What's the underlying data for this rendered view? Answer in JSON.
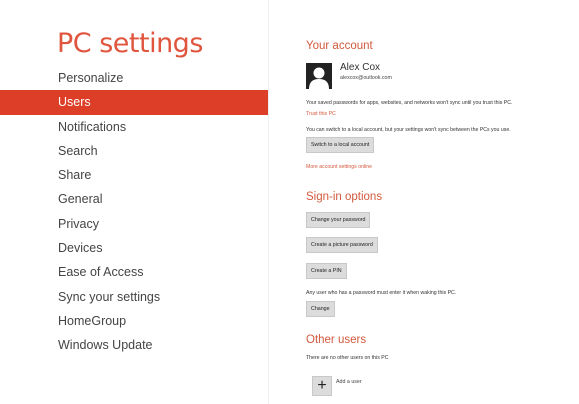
{
  "sidebar": {
    "title": "PC settings",
    "items": [
      {
        "label": "Personalize",
        "active": false
      },
      {
        "label": "Users",
        "active": true
      },
      {
        "label": "Notifications",
        "active": false
      },
      {
        "label": "Search",
        "active": false
      },
      {
        "label": "Share",
        "active": false
      },
      {
        "label": "General",
        "active": false
      },
      {
        "label": "Privacy",
        "active": false
      },
      {
        "label": "Devices",
        "active": false
      },
      {
        "label": "Ease of Access",
        "active": false
      },
      {
        "label": "Sync your settings",
        "active": false
      },
      {
        "label": "HomeGroup",
        "active": false
      },
      {
        "label": "Windows Update",
        "active": false
      }
    ]
  },
  "account": {
    "heading": "Your account",
    "user_name": "Alex Cox",
    "user_email": "alexcox@outlook.com",
    "trust_notice": "Your saved passwords for apps, websites, and networks won't sync until you trust this PC.",
    "trust_link": "Trust this PC",
    "local_notice": "You can switch to a local account, but your settings won't sync between the PCs you use.",
    "switch_button": "Switch to a local account",
    "more_link": "More account settings online"
  },
  "signin": {
    "heading": "Sign-in options",
    "change_password_button": "Change your password",
    "picture_password_button": "Create a picture password",
    "pin_button": "Create a PIN",
    "wake_notice": "Any user who has a password must enter it when waking this PC.",
    "change_button": "Change"
  },
  "other_users": {
    "heading": "Other users",
    "notice": "There are no other users on this PC",
    "add_icon_glyph": "+",
    "add_label": "Add a user"
  },
  "colors": {
    "accent": "#dd3e28",
    "heading": "#d2593d",
    "title": "#e0553e"
  }
}
